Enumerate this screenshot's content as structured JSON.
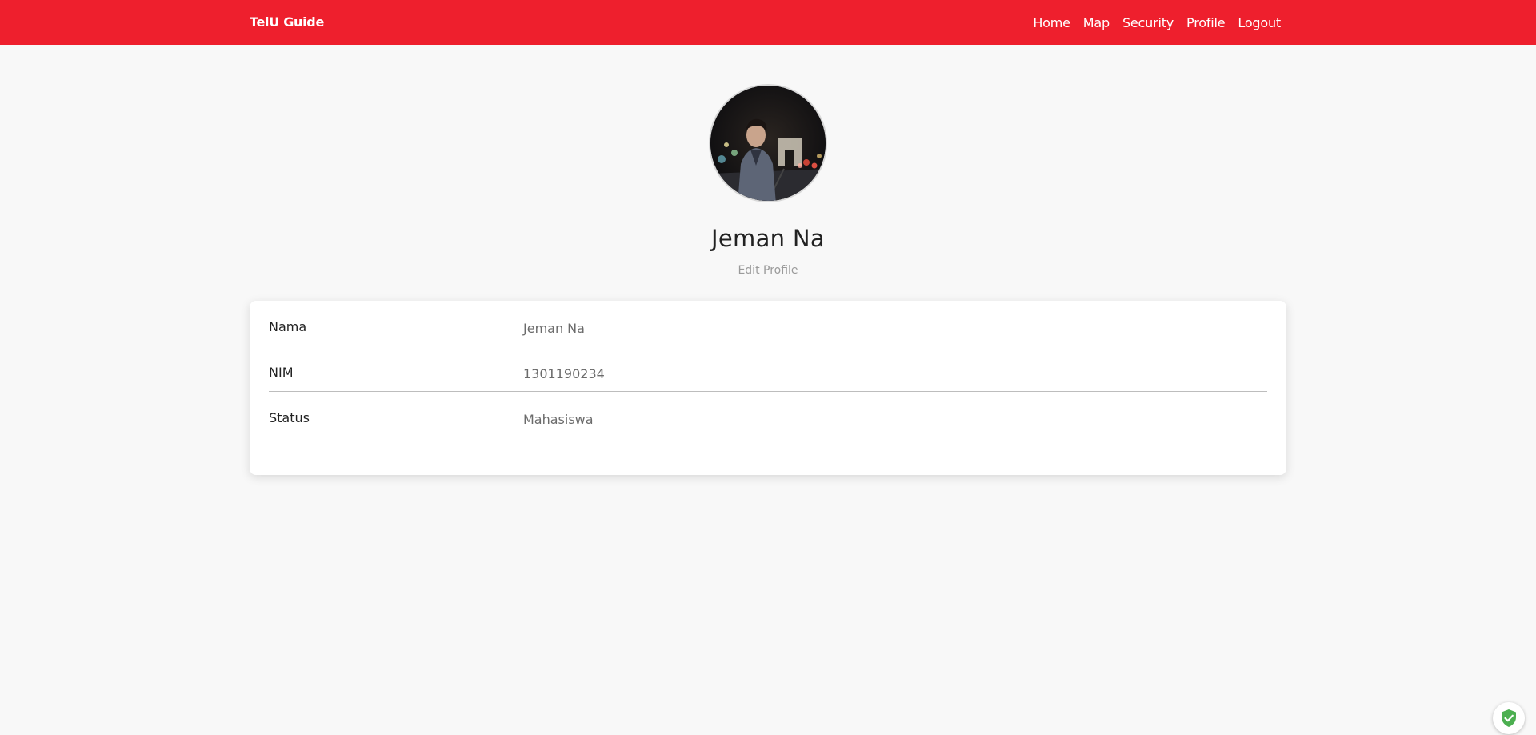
{
  "navbar": {
    "brand": "TelU Guide",
    "links": [
      "Home",
      "Map",
      "Security",
      "Profile",
      "Logout"
    ],
    "background_color": "#ee1f2d"
  },
  "profile": {
    "name": "Jeman Na",
    "edit_label": "Edit Profile",
    "avatar": "profile-photo"
  },
  "details": [
    {
      "label": "Nama",
      "value": "Jeman Na"
    },
    {
      "label": "NIM",
      "value": "1301190234"
    },
    {
      "label": "Status",
      "value": "Mahasiswa"
    }
  ],
  "widget": {
    "icon": "shield-check-icon",
    "color": "#4caf50"
  }
}
